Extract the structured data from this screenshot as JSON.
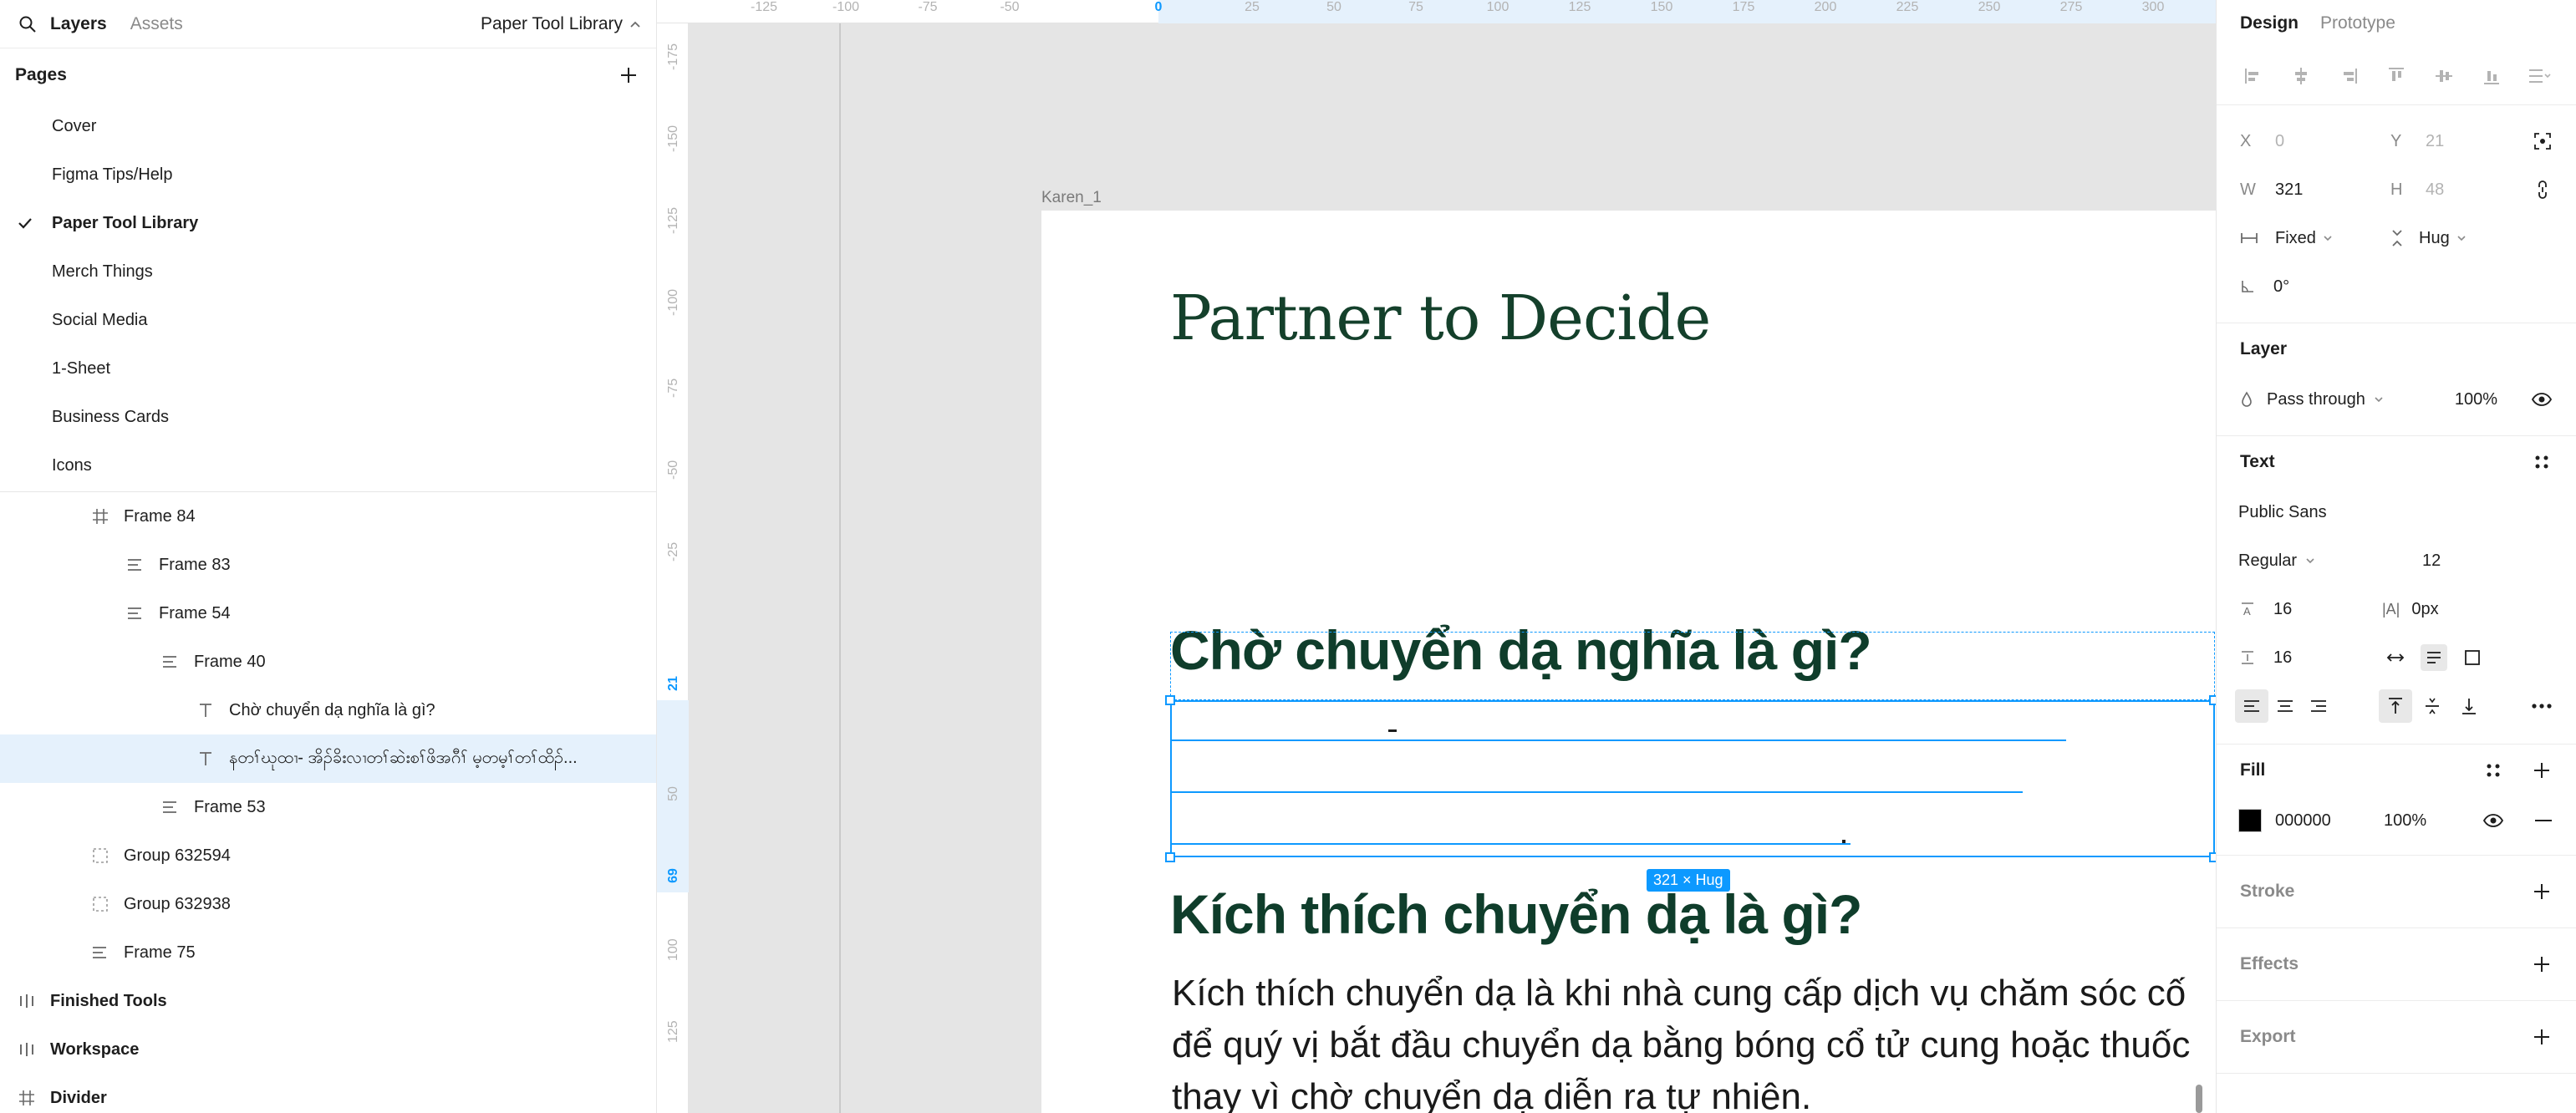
{
  "left_panel": {
    "tabs": {
      "layers": "Layers",
      "assets": "Assets"
    },
    "library_name": "Paper Tool Library",
    "pages_title": "Pages",
    "pages": [
      "Cover",
      "Figma Tips/Help",
      "Paper Tool Library",
      "Merch Things",
      "Social Media",
      "1-Sheet",
      "Business Cards",
      "Icons"
    ],
    "current_page": "Paper Tool Library",
    "layers": [
      {
        "name": "Frame 84",
        "icon": "frame-icon"
      },
      {
        "name": "Frame 83",
        "icon": "autolayout-icon"
      },
      {
        "name": "Frame 54",
        "icon": "autolayout-icon"
      },
      {
        "name": "Frame 40",
        "icon": "autolayout-icon"
      },
      {
        "name": "Chờ chuyển dạ nghĩa là gì?",
        "icon": "text-icon"
      },
      {
        "name": "နတၢ်ဃုထၢ- အိၣ်ခိးလၢတၢ်ဆဲးစၢ်ဖိအဂီၢ် မ့တမ့ၢ်တၢ်ထိၣ်...",
        "icon": "text-icon",
        "selected": true
      },
      {
        "name": "Frame 53",
        "icon": "autolayout-icon"
      },
      {
        "name": "Group 632594",
        "icon": "group-icon"
      },
      {
        "name": "Group 632938",
        "icon": "group-icon"
      },
      {
        "name": "Frame 75",
        "icon": "autolayout-icon"
      },
      {
        "name": "Finished Tools",
        "icon": "columns-icon",
        "top": true
      },
      {
        "name": "Workspace",
        "icon": "columns-icon",
        "top": true
      },
      {
        "name": "Divider",
        "icon": "frame-icon",
        "top": true
      }
    ]
  },
  "canvas": {
    "ruler_top": [
      "-125",
      "-100",
      "-75",
      "-50",
      "0",
      "25",
      "50",
      "75",
      "100",
      "125",
      "150",
      "175",
      "200",
      "225",
      "250",
      "275",
      "300"
    ],
    "ruler_left": [
      "-175",
      "-150",
      "-125",
      "-100",
      "-75",
      "-50",
      "-25",
      "21",
      "50",
      "69",
      "100",
      "125"
    ],
    "frame_label": "Karen_1",
    "logo_title": "Partner to Decide",
    "heading1": "Chờ chuyển dạ nghĩa là gì?",
    "heading2": "Kích thích chuyển dạ là gì?",
    "paragraph": "Kích thích chuyển dạ là khi nhà cung cấp dịch vụ chăm sóc cố để quý vị bắt đầu chuyển dạ bằng bóng cổ tử cung hoặc thuốc thay vì chờ chuyển dạ diễn ra tự nhiên.",
    "size_tag": "321 × Hug",
    "selection_color": "#0d99ff",
    "heading_color": "#0f3d2b"
  },
  "right_panel": {
    "tabs": {
      "design": "Design",
      "prototype": "Prototype"
    },
    "x_label": "X",
    "x_value": "0",
    "y_label": "Y",
    "y_value": "21",
    "w_label": "W",
    "w_value": "321",
    "h_label": "H",
    "h_value": "48",
    "width_mode": "Fixed",
    "height_mode": "Hug",
    "rotation": "0°",
    "layer_title": "Layer",
    "blend_mode": "Pass through",
    "layer_opacity": "100%",
    "text_title": "Text",
    "font_family": "Public Sans",
    "font_weight": "Regular",
    "font_size": "12",
    "line_height": "16",
    "letter_spacing": "0px",
    "paragraph_spacing": "16",
    "fill_title": "Fill",
    "fill_hex": "000000",
    "fill_color": "#000000",
    "fill_opacity": "100%",
    "stroke_title": "Stroke",
    "effects_title": "Effects",
    "export_title": "Export"
  }
}
